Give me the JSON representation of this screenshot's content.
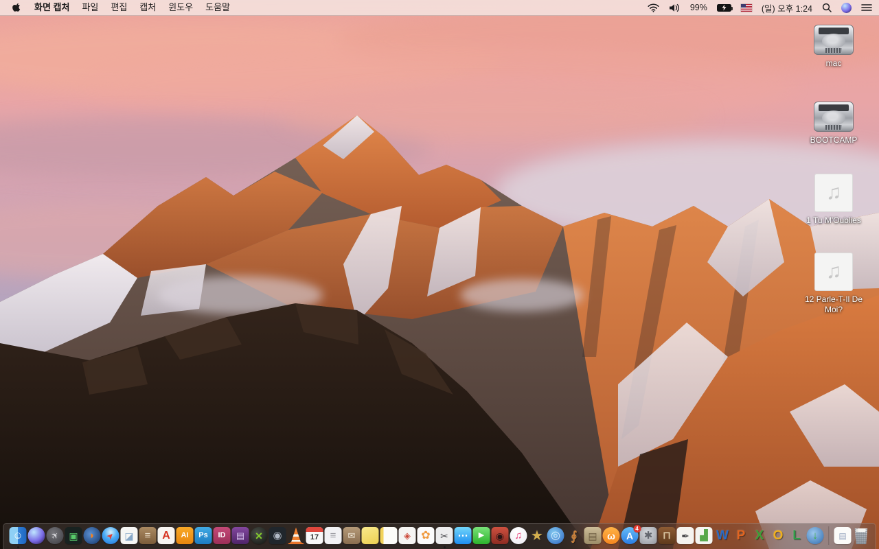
{
  "menu_bar": {
    "apple_icon": "apple-logo",
    "app_menus": [
      {
        "label": "화면 캡처",
        "bold": true
      },
      {
        "label": "파일"
      },
      {
        "label": "편집"
      },
      {
        "label": "캡처"
      },
      {
        "label": "윈도우"
      },
      {
        "label": "도움말"
      }
    ],
    "status": {
      "battery_percent": "99%",
      "battery_state": "charging",
      "input_source_flag": "us-flag",
      "clock": "(일) 오후 1:24"
    },
    "status_icons": [
      "wifi-icon",
      "volume-icon",
      "battery-charging-icon",
      "us-flag-icon",
      "spotlight-icon",
      "siri-icon",
      "notification-center-icon"
    ]
  },
  "desktop": {
    "icons": [
      {
        "id": "mac",
        "kind": "hdd",
        "label": "mac"
      },
      {
        "id": "bootcamp",
        "kind": "hdd",
        "label": "BOOTCAMP"
      },
      {
        "id": "song-1",
        "kind": "audio",
        "label": "1 Tu M'Oublies"
      },
      {
        "id": "song-2",
        "kind": "audio",
        "label": "12 Parle-T-Il De Moi?"
      }
    ],
    "audio_glyph": "♫"
  },
  "dock": {
    "items": [
      {
        "id": "finder",
        "label": "Finder",
        "running": true,
        "shape": "sq",
        "bg": "linear-gradient(90deg,#8ed0f5 0%,#8ed0f5 50%,#2f7fd6 50%,#1f66c0 100%)",
        "glyph": "☺",
        "fg": "#ffffff",
        "fs": 15
      },
      {
        "id": "siri",
        "label": "Siri",
        "shape": "ci",
        "bg": "radial-gradient(circle at 35% 30%,#bfe6ff,#7a6ae6 55%,#1d1242)",
        "glyph": "",
        "fg": "#fff",
        "fs": 10
      },
      {
        "id": "launchpad",
        "label": "Launchpad",
        "shape": "ci",
        "bg": "radial-gradient(circle at 40% 35%,#77777c,#3b3b40)",
        "glyph": "✈",
        "fg": "#d8d8dc",
        "fs": 13,
        "rot": -45
      },
      {
        "id": "window-manager",
        "label": "Window Manager",
        "shape": "sq",
        "bg": "#182220",
        "glyph": "▣",
        "fg": "#58c96a",
        "fs": 14
      },
      {
        "id": "firefox",
        "label": "Firefox",
        "shape": "ci",
        "bg": "radial-gradient(circle at 40% 40%,#5b8fd0,#123568)",
        "glyph": "◗",
        "fg": "#f5821e",
        "fs": 15,
        "b": 1
      },
      {
        "id": "safari",
        "label": "Safari",
        "shape": "ci",
        "bg": "radial-gradient(circle at 50% 30%,#d8f0fa,#4aacf5 45%,#1e6fd6)",
        "glyph": "➤",
        "fg": "#e03c31",
        "fs": 12,
        "rot": -45
      },
      {
        "id": "preview",
        "label": "Preview",
        "shape": "sq",
        "bg": "#f6f6f4",
        "glyph": "◪",
        "fg": "#87a8c8",
        "fs": 14
      },
      {
        "id": "contacts",
        "label": "Contacts",
        "shape": "sq",
        "bg": "linear-gradient(180deg,#ab8a62,#7c5c3a)",
        "glyph": "≡",
        "fg": "#ecdfca",
        "fs": 15,
        "b": 1
      },
      {
        "id": "acrobat-reader",
        "label": "Adobe Acrobat Reader",
        "shape": "sq",
        "bg": "#f7f4f1",
        "glyph": "A",
        "fg": "#d6311f",
        "fs": 16,
        "b": 1
      },
      {
        "id": "illustrator",
        "label": "Adobe Illustrator",
        "shape": "sq",
        "bg": "linear-gradient(180deg,#f9a928,#e8860f)",
        "glyph": "Ai",
        "fg": "#ffffff",
        "fs": 11,
        "b": 1
      },
      {
        "id": "photoshop",
        "label": "Adobe Photoshop",
        "shape": "sq",
        "bg": "linear-gradient(180deg,#41aae4,#1c7cc2)",
        "glyph": "Ps",
        "fg": "#ffffff",
        "fs": 11,
        "b": 1
      },
      {
        "id": "indesign",
        "label": "Adobe InDesign",
        "shape": "sq",
        "bg": "linear-gradient(180deg,#c44a78,#9c2f58)",
        "glyph": "ID",
        "fg": "#ffffff",
        "fs": 11,
        "b": 1
      },
      {
        "id": "toast",
        "label": "Toast Titanium",
        "shape": "sq",
        "bg": "linear-gradient(180deg,#83479f,#4e2468)",
        "glyph": "▤",
        "fg": "#d9c2f0",
        "fs": 13
      },
      {
        "id": "video-converter",
        "label": "Video Converter",
        "shape": "ci",
        "bg": "radial-gradient(circle at 40% 35%,#4a4f48,#101310)",
        "glyph": "×",
        "fg": "#84cc2e",
        "fs": 18,
        "b": 1
      },
      {
        "id": "disk-tool",
        "label": "Disk Tool",
        "shape": "sq",
        "bg": "#20262c",
        "glyph": "◉",
        "fg": "#b2bac6",
        "fs": 15
      },
      {
        "id": "vlc",
        "label": "VLC",
        "shape": "sq",
        "bg": "",
        "glyph": "",
        "fg": "#fff",
        "fs": 10
      },
      {
        "id": "calendar",
        "label": "Calendar",
        "shape": "sq",
        "bg": "#f8f8f8",
        "glyph": "17",
        "fg": "#333333",
        "fs": 11,
        "b": 1
      },
      {
        "id": "reminders",
        "label": "Reminders",
        "shape": "sq",
        "bg": "#f2f2f4",
        "glyph": "≡",
        "fg": "#9a9aa0",
        "fs": 15
      },
      {
        "id": "mail-archive",
        "label": "Mail Archive",
        "shape": "sq",
        "bg": "linear-gradient(180deg,#b59a78,#8a6e50)",
        "glyph": "✉",
        "fg": "#efe6d6",
        "fs": 13
      },
      {
        "id": "stickies",
        "label": "Stickies",
        "shape": "sq",
        "bg": "linear-gradient(160deg,#f9ea8c,#ecd052)",
        "glyph": "",
        "fg": "#fff",
        "fs": 10
      },
      {
        "id": "notes",
        "label": "Notepad",
        "shape": "sq",
        "bg": "linear-gradient(90deg,#f2d35a 0 20%,#fcfcf8 20%)",
        "glyph": "",
        "fg": "#fff",
        "fs": 10
      },
      {
        "id": "doc-viewer",
        "label": "Document Viewer",
        "shape": "sq",
        "bg": "#f5f5f3",
        "glyph": "◈",
        "fg": "#cc4a3a",
        "fs": 13
      },
      {
        "id": "photos",
        "label": "Photos",
        "shape": "sq",
        "bg": "#fbfbfb",
        "glyph": "✿",
        "fg": "#f09a3e",
        "fs": 16
      },
      {
        "id": "grab",
        "label": "화면 캡처",
        "running": true,
        "shape": "sq",
        "bg": "#ededee",
        "glyph": "✂",
        "fg": "#4a4a4e",
        "fs": 14
      },
      {
        "id": "messages",
        "label": "Messages",
        "shape": "sq",
        "bg": "linear-gradient(180deg,#72d6fb,#1d8ef0)",
        "glyph": "⋯",
        "fg": "#ffffff",
        "fs": 15,
        "b": 1
      },
      {
        "id": "facetime",
        "label": "FaceTime",
        "shape": "sq",
        "bg": "linear-gradient(180deg,#79e279,#2cb42c)",
        "glyph": "▶",
        "fg": "#ffffff",
        "fs": 11
      },
      {
        "id": "photo-booth",
        "label": "Photo Booth",
        "shape": "sq",
        "bg": "linear-gradient(180deg,#cf5140,#8c2c22)",
        "glyph": "◉",
        "fg": "#2a1414",
        "fs": 14
      },
      {
        "id": "itunes",
        "label": "iTunes",
        "shape": "ci",
        "bg": "radial-gradient(circle at 40% 30%,#ffffff,#eceaf0)",
        "glyph": "♫",
        "fg": "#e8467c",
        "fs": 15
      },
      {
        "id": "imovie",
        "label": "iMovie",
        "shape": "none",
        "bg": "",
        "glyph": "★",
        "fg": "#d4af4e",
        "fs": 20,
        "sh": 1
      },
      {
        "id": "idvd",
        "label": "iDVD",
        "shape": "ci",
        "bg": "radial-gradient(circle at 40% 35%,#86ccf2,#2a62be)",
        "glyph": "◎",
        "fg": "#d6ecff",
        "fs": 16
      },
      {
        "id": "garageband",
        "label": "GarageBand",
        "shape": "none",
        "bg": "",
        "glyph": "∮",
        "fg": "#c9813c",
        "fs": 18,
        "b": 1,
        "sh": 1
      },
      {
        "id": "news-collage",
        "label": "News Collage",
        "shape": "sq",
        "bg": "linear-gradient(180deg,#cdbd98,#9c8c68)",
        "glyph": "▤",
        "fg": "#6b5b40",
        "fs": 14
      },
      {
        "id": "ibooks",
        "label": "iBooks",
        "shape": "ci",
        "bg": "linear-gradient(180deg,#ffb347,#f5861f)",
        "glyph": "ω",
        "fg": "#ffffff",
        "fs": 14,
        "b": 1
      },
      {
        "id": "app-store",
        "label": "App Store",
        "badge": "4",
        "shape": "ci",
        "bg": "linear-gradient(180deg,#66bdf8,#2a7ce2)",
        "glyph": "A",
        "fg": "#ffffff",
        "fs": 14,
        "b": 1
      },
      {
        "id": "system-preferences",
        "label": "System Preferences",
        "shape": "sq",
        "bg": "radial-gradient(circle at 45% 35%,#d8dbdf,#92969d)",
        "glyph": "✱",
        "fg": "#63676e",
        "fs": 15
      },
      {
        "id": "keynote",
        "label": "Keynote",
        "shape": "sq",
        "bg": "linear-gradient(180deg,#8e5c34,#5e3a1c)",
        "glyph": "⊓",
        "fg": "#d8c4a0",
        "fs": 15,
        "b": 1
      },
      {
        "id": "pages",
        "label": "Pages",
        "shape": "sq",
        "bg": "#f5f3ef",
        "glyph": "✒",
        "fg": "#3f3f42",
        "fs": 14
      },
      {
        "id": "numbers",
        "label": "Numbers",
        "shape": "sq",
        "bg": "#f4f4f0",
        "glyph": "▟",
        "fg": "#57a84a",
        "fs": 15
      },
      {
        "id": "word",
        "label": "Microsoft Word",
        "shape": "none",
        "bg": "",
        "glyph": "W",
        "fg": "#2a6bc4",
        "fs": 19,
        "b": 1,
        "sh": 1
      },
      {
        "id": "powerpoint",
        "label": "Microsoft PowerPoint",
        "shape": "none",
        "bg": "",
        "glyph": "P",
        "fg": "#e2641f",
        "fs": 19,
        "b": 1,
        "sh": 1
      },
      {
        "id": "excel",
        "label": "Microsoft Excel",
        "shape": "none",
        "bg": "",
        "glyph": "X",
        "fg": "#3f9e38",
        "fs": 19,
        "b": 1,
        "sh": 1
      },
      {
        "id": "outlook",
        "label": "Microsoft Outlook",
        "shape": "none",
        "bg": "",
        "glyph": "O",
        "fg": "#efb020",
        "fs": 19,
        "b": 1,
        "sh": 1
      },
      {
        "id": "lync",
        "label": "Microsoft Lync",
        "shape": "none",
        "bg": "",
        "glyph": "L",
        "fg": "#2f9e48",
        "fs": 19,
        "b": 1,
        "sh": 1
      },
      {
        "id": "download-manager",
        "label": "Download Manager",
        "shape": "ci",
        "bg": "radial-gradient(circle at 40% 35%,#9cc8ec,#2f6cb0)",
        "glyph": "↓",
        "fg": "#3fae3f",
        "fs": 15,
        "b": 1
      },
      {
        "divider": true
      },
      {
        "id": "document-file",
        "label": "Document",
        "shape": "sq",
        "bg": "#fbfbf9",
        "glyph": "▤",
        "fg": "#9aa8c0",
        "fs": 12
      },
      {
        "id": "trash",
        "label": "Trash",
        "trash_full": true,
        "shape": "sq",
        "bg": "",
        "glyph": "",
        "fg": "#fff",
        "fs": 10
      }
    ]
  }
}
